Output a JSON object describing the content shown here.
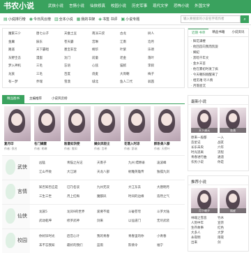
{
  "header": {
    "logo": "书农小说",
    "nav": [
      "武侠小说",
      "言情小说",
      "仙侠修真",
      "校园小说",
      "历史军事",
      "现代文学",
      "恐怖小说",
      "外国文学"
    ]
  },
  "subbar": {
    "links": [
      "小说排行榜",
      "今日风云榜",
      "全本小说",
      "我的书架",
      "书签 书评",
      "小说专题"
    ],
    "search_placeholder": "输入要搜索的小说名字或作者"
  },
  "tags": [
    [
      "魔家三少",
      "唐七公子",
      "天蚕土豆",
      "南派三叔",
      "古龙",
      "树人"
    ],
    [
      "金庸",
      "辰东",
      "苍天霸",
      "宫琳",
      "江南",
      "沧月"
    ],
    [
      "路遥",
      "天下霸唱",
      "墨宝非宝",
      "桐华",
      "叶紫",
      "乐颂"
    ],
    [
      "东野圭吾",
      "漫蚩",
      "沈门",
      "前童",
      "老金",
      "落叶"
    ],
    [
      "梦入神机",
      "三毛",
      "忘语",
      "心弦",
      "猫腻",
      "李叙"
    ],
    [
      "龙族",
      "三毛",
      "百度",
      "烧麦",
      "大周朝",
      "梅子"
    ],
    [
      "有一梦",
      "乔瑞",
      "雪漠",
      "城北",
      "鱼人二代",
      "翁茜"
    ]
  ],
  "rank": {
    "tabs": [
      "近期 书单",
      "精品书籍",
      "小说资讯"
    ],
    "items": [
      "鲜花满楼",
      "他回首向我而凯旋",
      "嫡妃",
      "黑暗千年文",
      "金乡天首",
      "他在雾初时发了疯",
      "今天朝阳刚醒来了",
      "相见难 尽人情",
      "月落星沉",
      "七斛"
    ]
  },
  "featured": {
    "tabs": [
      "精品图书",
      "主编推荐",
      "小说风云榜"
    ],
    "books": [
      {
        "title": "复月印",
        "author": "作者: 佚名"
      },
      {
        "title": "名门嫡妻",
        "author": "作者: 勒琳"
      },
      {
        "title": "医意如洪使",
        "author": "作者: 鬼知"
      },
      {
        "title": "嫡女凤轻尘",
        "author": "作者: 言希"
      },
      {
        "title": "花落入时凉",
        "author": "作者: 凯瑞"
      },
      {
        "title": "醉卧美人膝",
        "author": "作者: 天榜叶"
      }
    ]
  },
  "categories": [
    {
      "name": "武侠",
      "rows": [
        [
          "凶猛",
          "青猫之光记",
          "天南子",
          "九州 缥缈录",
          "凌波峰"
        ],
        [
          "江山不败",
          "大江湖",
          "天龙八部",
          "射雕英雄传",
          "独孤九剑"
        ]
      ]
    },
    {
      "name": "言情",
      "rows": [
        [
          "知否知否应是",
          "已乃名谈",
          "九州无双",
          "大江东去",
          "大唐明月"
        ],
        [
          "三生三世",
          "月上红梅",
          "魔都凤",
          "时间的边缘",
          "浩然之气"
        ]
      ]
    },
    {
      "name": "仙侠",
      "rows": [
        [
          "龙族5",
          "龙凤9的世界",
          "爱要不能",
          "斗破苍穹",
          "斗罗大陆"
        ],
        [
          "武动乾坤",
          "修罗武神",
          "剑来",
          "以仙道门",
          "无尽武装"
        ]
      ]
    },
    {
      "name": "校园",
      "rows": [
        [
          "你好旧时光",
          "后宫心计",
          "我的青春",
          "青春里的你",
          "小青春"
        ],
        [
          "末不忘我知",
          "最好的我们",
          "蓝雨",
          "陈情令",
          "福宁"
        ]
      ]
    }
  ],
  "hot": {
    "title": "最新小说",
    "covers": [
      "天下清元",
      "花落"
    ],
    "items": [
      [
        "原来一般都",
        "一入"
      ],
      [
        "造星记",
        "战友"
      ],
      [
        "长乐未央",
        "六年"
      ],
      [
        "时光逃离",
        "流程"
      ],
      [
        "青春进行曲",
        "通道"
      ],
      [
        "农民小说",
        "你是"
      ]
    ]
  },
  "recommend": {
    "title": "推荐小说",
    "covers": [
      "月下朝夕",
      "孤星"
    ],
    "items": [
      [
        "林端之雪息",
        "竹木"
      ],
      [
        "人到中年",
        "宣宗"
      ],
      [
        "生存故事",
        "红色"
      ],
      [
        "大多人",
        "大梦"
      ],
      [
        "永夜明",
        "雨夜"
      ],
      [
        "出来",
        "剑"
      ]
    ]
  },
  "colors": {
    "brand": "#3aa25e"
  }
}
